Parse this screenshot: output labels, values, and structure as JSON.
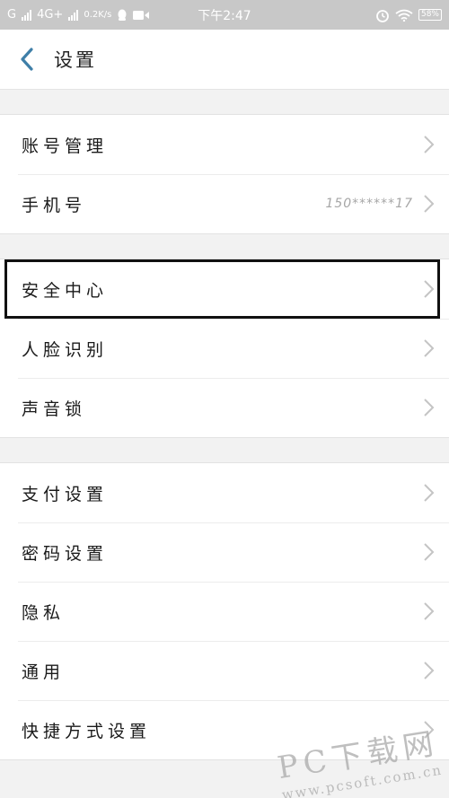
{
  "status_bar": {
    "carrier1": "G",
    "network": "4G+",
    "speed": "0.2K/s",
    "time": "下午2:47",
    "battery": "58%"
  },
  "header": {
    "title": "设置"
  },
  "groups": [
    {
      "items": [
        {
          "label": "账号管理"
        },
        {
          "label": "手机号",
          "value": "150******17"
        }
      ]
    },
    {
      "items": [
        {
          "label": "安全中心"
        },
        {
          "label": "人脸识别"
        },
        {
          "label": "声音锁"
        }
      ]
    },
    {
      "items": [
        {
          "label": "支付设置"
        },
        {
          "label": "密码设置"
        },
        {
          "label": "隐私"
        },
        {
          "label": "通用"
        },
        {
          "label": "快捷方式设置"
        }
      ]
    }
  ],
  "watermark": {
    "line1": "PC下载网",
    "line2": "www.pcsoft.com.cn"
  },
  "colors": {
    "accent_back_arrow": "#3f7fa8",
    "highlight_box": "#111111",
    "status_bar_bg": "#c8c8c8"
  }
}
